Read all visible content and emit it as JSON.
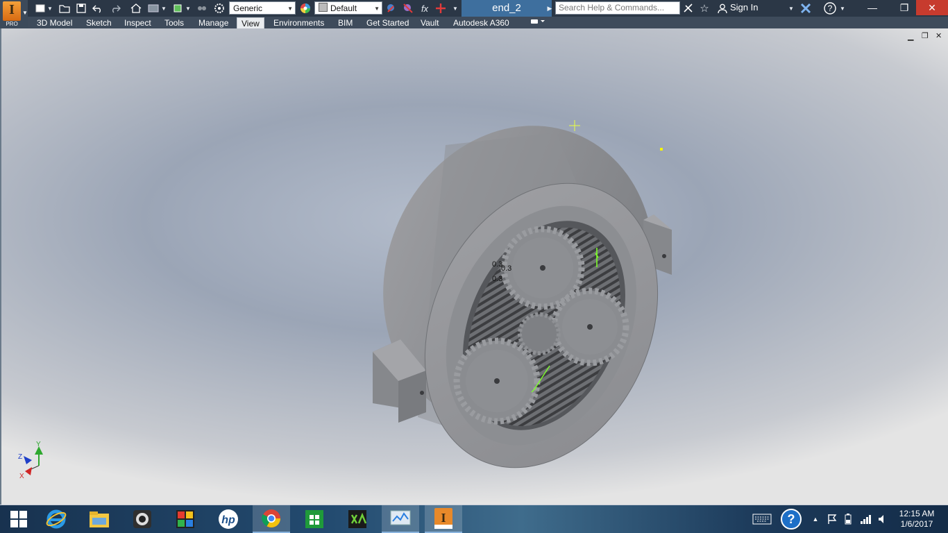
{
  "app": {
    "logo_letter": "I",
    "edition": "PRO",
    "document_title": "end_2",
    "material_value": "Generic",
    "appearance_value": "Default",
    "search_placeholder": "Search Help & Commands...",
    "sign_in_label": "Sign In",
    "fx_label": "fx"
  },
  "ribbon_tabs": [
    {
      "label": "3D Model"
    },
    {
      "label": "Sketch"
    },
    {
      "label": "Inspect"
    },
    {
      "label": "Tools"
    },
    {
      "label": "Manage"
    },
    {
      "label": "View",
      "active": true
    },
    {
      "label": "Environments"
    },
    {
      "label": "BIM"
    },
    {
      "label": "Get Started"
    },
    {
      "label": "Vault"
    },
    {
      "label": "Autodesk A360"
    }
  ],
  "viewport": {
    "dimension_labels": [
      "0.3",
      "0.3",
      "0.3"
    ],
    "axis_labels": {
      "x": "X",
      "y": "Y",
      "z": "Z"
    }
  },
  "colors": {
    "title_bar": "#2b3746",
    "document_tab": "#3e6f9e",
    "ribbon_bar": "#3e4b5b",
    "model_gray": "#8a8d92",
    "sketch_green": "#7dff2a",
    "close_button": "#c73b2e"
  },
  "taskbar": {
    "apps": [
      {
        "icon": "windows-start-icon"
      },
      {
        "icon": "internet-explorer-icon"
      },
      {
        "icon": "file-explorer-icon"
      },
      {
        "icon": "webcam-icon"
      },
      {
        "icon": "puzzle-game-icon"
      },
      {
        "icon": "hp-icon"
      },
      {
        "icon": "chrome-icon"
      },
      {
        "icon": "store-icon"
      },
      {
        "icon": "camtasia-icon"
      },
      {
        "icon": "task-manager-icon"
      },
      {
        "icon": "inventor-icon",
        "active": true
      }
    ],
    "time": "12:15 AM",
    "date": "1/6/2017"
  }
}
